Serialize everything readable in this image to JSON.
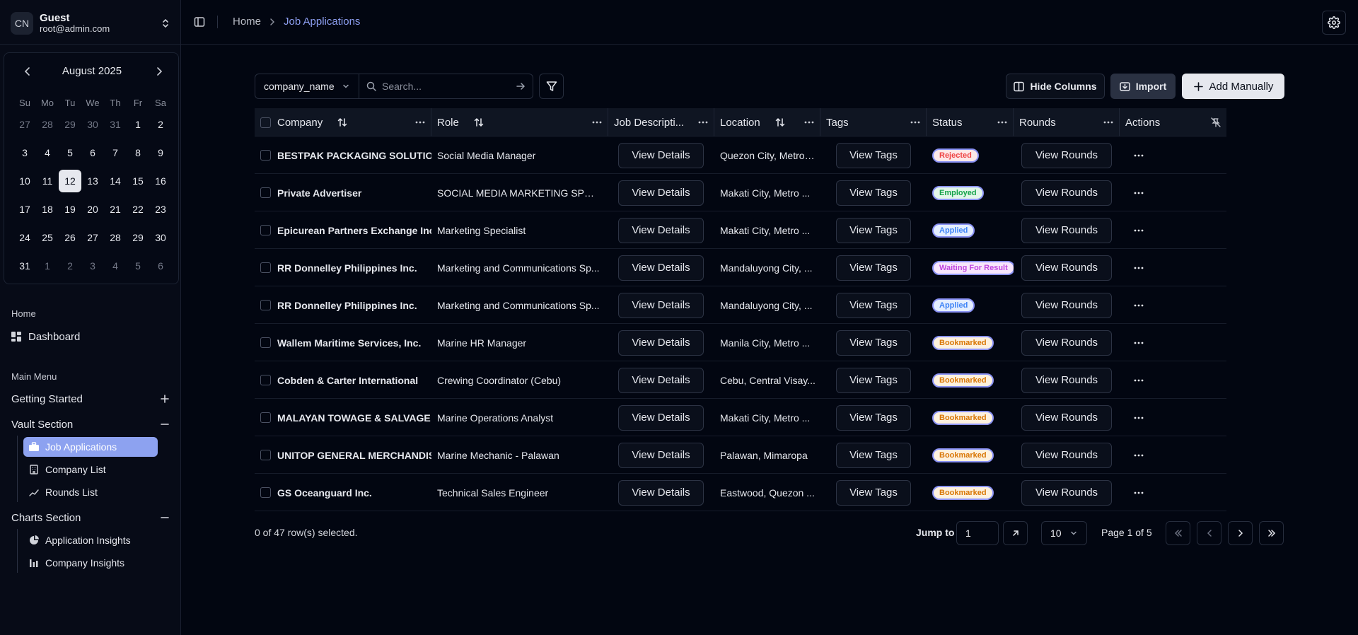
{
  "user": {
    "initials": "CN",
    "name": "Guest",
    "email": "root@admin.com"
  },
  "calendar": {
    "month_label": "August 2025",
    "weekdays": [
      "Su",
      "Mo",
      "Tu",
      "We",
      "Th",
      "Fr",
      "Sa"
    ],
    "days": [
      {
        "d": "27",
        "out": true
      },
      {
        "d": "28",
        "out": true
      },
      {
        "d": "29",
        "out": true
      },
      {
        "d": "30",
        "out": true
      },
      {
        "d": "31",
        "out": true
      },
      {
        "d": "1"
      },
      {
        "d": "2"
      },
      {
        "d": "3"
      },
      {
        "d": "4"
      },
      {
        "d": "5"
      },
      {
        "d": "6"
      },
      {
        "d": "7"
      },
      {
        "d": "8"
      },
      {
        "d": "9"
      },
      {
        "d": "10"
      },
      {
        "d": "11"
      },
      {
        "d": "12",
        "selected": true
      },
      {
        "d": "13"
      },
      {
        "d": "14"
      },
      {
        "d": "15"
      },
      {
        "d": "16"
      },
      {
        "d": "17"
      },
      {
        "d": "18"
      },
      {
        "d": "19"
      },
      {
        "d": "20"
      },
      {
        "d": "21"
      },
      {
        "d": "22"
      },
      {
        "d": "23"
      },
      {
        "d": "24"
      },
      {
        "d": "25"
      },
      {
        "d": "26"
      },
      {
        "d": "27"
      },
      {
        "d": "28"
      },
      {
        "d": "29"
      },
      {
        "d": "30"
      },
      {
        "d": "31"
      },
      {
        "d": "1",
        "out": true
      },
      {
        "d": "2",
        "out": true
      },
      {
        "d": "3",
        "out": true
      },
      {
        "d": "4",
        "out": true
      },
      {
        "d": "5",
        "out": true
      },
      {
        "d": "6",
        "out": true
      }
    ]
  },
  "sidebar": {
    "home_label": "Home",
    "dashboard": "Dashboard",
    "main_menu_label": "Main Menu",
    "getting_started": "Getting Started",
    "vault_section": "Vault Section",
    "vault_items": [
      "Job Applications",
      "Company List",
      "Rounds List"
    ],
    "charts_section": "Charts Section",
    "chart_items": [
      "Application Insights",
      "Company Insights"
    ]
  },
  "breadcrumb": {
    "home": "Home",
    "current": "Job Applications"
  },
  "toolbar": {
    "filter_field": "company_name",
    "search_placeholder": "Search...",
    "hide_columns": "Hide Columns",
    "import": "Import",
    "add_manually": "Add Manually"
  },
  "table": {
    "headers": [
      "Company",
      "Role",
      "Job Descripti...",
      "Location",
      "Tags",
      "Status",
      "Rounds",
      "Actions"
    ],
    "details_label": "View Details",
    "tags_label": "View Tags",
    "rounds_label": "View Rounds",
    "rows": [
      {
        "company": "BESTPAK PACKAGING SOLUTIONS",
        "role": "Social Media Manager",
        "location": "Quezon City, Metro ...",
        "status": "Rejected"
      },
      {
        "company": "Private Advertiser",
        "role": "SOCIAL MEDIA MARKETING SPECI...",
        "location": "Makati City, Metro ...",
        "status": "Employed"
      },
      {
        "company": "Epicurean Partners Exchange Inc.",
        "role": "Marketing Specialist",
        "location": "Makati City, Metro ...",
        "status": "Applied"
      },
      {
        "company": "RR Donnelley Philippines Inc.",
        "role": "Marketing and Communications Sp...",
        "location": "Mandaluyong City, ...",
        "status": "Waiting For Result"
      },
      {
        "company": "RR Donnelley Philippines Inc.",
        "role": "Marketing and Communications Sp...",
        "location": "Mandaluyong City, ...",
        "status": "Applied"
      },
      {
        "company": "Wallem Maritime Services, Inc.",
        "role": "Marine HR Manager",
        "location": "Manila City, Metro ...",
        "status": "Bookmarked"
      },
      {
        "company": "Cobden & Carter International",
        "role": "Crewing Coordinator (Cebu)",
        "location": "Cebu, Central Visay...",
        "status": "Bookmarked"
      },
      {
        "company": "MALAYAN TOWAGE & SALVAGE CO",
        "role": "Marine Operations Analyst",
        "location": "Makati City, Metro ...",
        "status": "Bookmarked"
      },
      {
        "company": "UNITOP GENERAL MERCHANDISE,",
        "role": "Marine Mechanic - Palawan",
        "location": "Palawan, Mimaropa",
        "status": "Bookmarked"
      },
      {
        "company": "GS Oceanguard Inc.",
        "role": "Technical Sales Engineer",
        "location": "Eastwood, Quezon ...",
        "status": "Bookmarked"
      }
    ]
  },
  "status_colors": {
    "Rejected": {
      "fg": "#ef4444",
      "bg": "#fde8e8",
      "border": "#8b93f5"
    },
    "Employed": {
      "fg": "#16a34a",
      "bg": "#e3f6e9",
      "border": "#8b93f5"
    },
    "Applied": {
      "fg": "#3b82f6",
      "bg": "#e4eefe",
      "border": "#8b93f5"
    },
    "Waiting For Result": {
      "fg": "#c045e0",
      "bg": "#f7e6fc",
      "border": "#8b93f5"
    },
    "Bookmarked": {
      "fg": "#d97706",
      "bg": "#fdf1de",
      "border": "#8b93f5"
    }
  },
  "footer": {
    "selected_text": "0 of 47 row(s) selected.",
    "jump_label": "Jump to",
    "jump_value": "1",
    "page_size": "10",
    "page_info": "Page 1 of 5"
  }
}
